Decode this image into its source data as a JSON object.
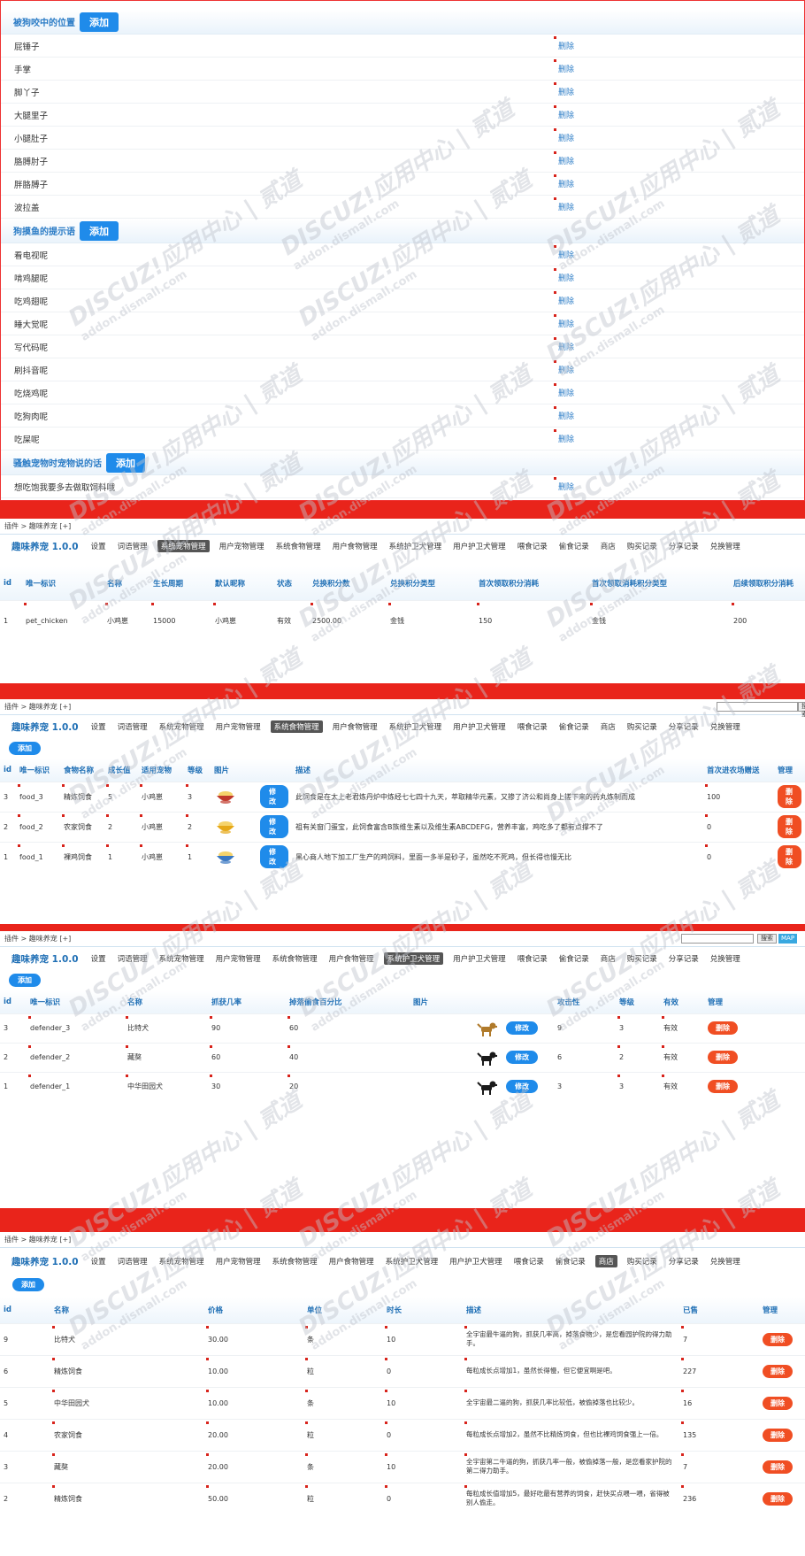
{
  "panel1": {
    "sections": [
      {
        "title": "被狗咬中的位置",
        "add_label": "添加",
        "items": [
          "屁锤子",
          "手掌",
          "脚丫子",
          "大腿里子",
          "小腿肚子",
          "胳膊肘子",
          "胖胳膊子",
          "波拉盖"
        ]
      },
      {
        "title": "狗摸鱼的提示语",
        "add_label": "添加",
        "items": [
          "看电视呢",
          "啃鸡腿呢",
          "吃鸡翅呢",
          "睡大觉呢",
          "写代码呢",
          "刷抖音呢",
          "吃烧鸡呢",
          "吃狗肉呢",
          "吃屎呢"
        ]
      },
      {
        "title": "骚触宠物时宠物说的话",
        "add_label": "添加",
        "items": [
          "想吃饱我要多去做取饲料哦"
        ]
      }
    ],
    "delete_label": "删除"
  },
  "nav": {
    "brand": "趣味养宠 1.0.0",
    "items": [
      "设置",
      "词语管理",
      "系统宠物管理",
      "用户宠物管理",
      "系统食物管理",
      "用户食物管理",
      "系统护卫犬管理",
      "用户护卫犬管理",
      "喂食记录",
      "偷食记录",
      "商店",
      "购买记录",
      "分享记录",
      "兑换管理"
    ]
  },
  "breadcrumb": "插件 > 趣味养宠 [+]",
  "add_label": "添加",
  "edit_label": "修改",
  "delete_label": "删除",
  "search_label": "搜索",
  "map_label": "MAP",
  "panel2": {
    "active_nav": "系统宠物管理",
    "headers": [
      "id",
      "唯一标识",
      "名称",
      "生长周期",
      "默认昵称",
      "状态",
      "兑换积分数",
      "兑换积分类型",
      "首次领取积分消耗",
      "首次领取消耗积分类型",
      "后续领取积分消耗"
    ],
    "rows": [
      [
        "1",
        "pet_chicken",
        "小鸡崽",
        "15000",
        "小鸡崽",
        "有效",
        "2500.00",
        "金钱",
        "150",
        "金钱",
        "200"
      ]
    ]
  },
  "panel3": {
    "active_nav": "系统食物管理",
    "headers": [
      "id",
      "唯一标识",
      "食物名称",
      "成长值",
      "适用宠物",
      "等级",
      "图片",
      "",
      "描述",
      "首次进农场赠送",
      "管理"
    ],
    "rows": [
      {
        "id": "3",
        "key": "food_3",
        "name": "精炼饲食",
        "growth": "5",
        "pet": "小鸡崽",
        "level": "3",
        "desc": "此饲食是在太上老君炼丹炉中炼经七七四十九天，萃取精华元素，又掺了济公和尚身上搓下来的药丸炼制而成",
        "gift": "100",
        "color": "#c0392b"
      },
      {
        "id": "2",
        "key": "food_2",
        "name": "农家饲食",
        "growth": "2",
        "pet": "小鸡崽",
        "level": "2",
        "desc": "祖有关窗门蛋宝，此饲食富含B族维生素以及维生素ABCDEFG，营养丰富，鸡吃多了都有点撑不了",
        "gift": "0",
        "color": "#e6a817"
      },
      {
        "id": "1",
        "key": "food_1",
        "name": "裸鸡饲食",
        "growth": "1",
        "pet": "小鸡崽",
        "level": "1",
        "desc": "黑心商人地下加工厂生产的鸡饲料，里面一多半是砂子，虽然吃不死鸡，但长得也慢无比",
        "gift": "0",
        "color": "#3a78c2"
      }
    ]
  },
  "panel4": {
    "active_nav": "系统护卫犬管理",
    "headers": [
      "id",
      "唯一标识",
      "名称",
      "抓获几率",
      "掉落偷食百分比",
      "图片",
      "",
      "攻击性",
      "等级",
      "有效",
      "管理"
    ],
    "rows": [
      {
        "id": "3",
        "key": "defender_3",
        "name": "比特犬",
        "rate": "90",
        "pct": "60",
        "attack": "9",
        "level": "3",
        "valid": "有效",
        "color": "#b07a2a"
      },
      {
        "id": "2",
        "key": "defender_2",
        "name": "藏獒",
        "rate": "60",
        "pct": "40",
        "attack": "6",
        "level": "2",
        "valid": "有效",
        "color": "#1a1a1a"
      },
      {
        "id": "1",
        "key": "defender_1",
        "name": "中华田园犬",
        "rate": "30",
        "pct": "20",
        "attack": "3",
        "level": "3",
        "valid": "有效",
        "color": "#1a1a1a"
      }
    ]
  },
  "panel5": {
    "active_nav": "商店",
    "headers": [
      "id",
      "名称",
      "价格",
      "单位",
      "时长",
      "描述",
      "已售",
      "管理"
    ],
    "rows": [
      {
        "id": "9",
        "name": "比特犬",
        "price": "30.00",
        "unit": "条",
        "dur": "10",
        "desc": "全宇宙最牛逼的狗，抓获几率高，掉落食物少，是您看园护院的得力助手。",
        "sold": "7"
      },
      {
        "id": "6",
        "name": "精炼饲食",
        "price": "10.00",
        "unit": "粒",
        "dur": "0",
        "desc": "每粒成长点增加1，虽然长得慢，但它便宜啊是吧。",
        "sold": "227"
      },
      {
        "id": "5",
        "name": "中华田园犬",
        "price": "10.00",
        "unit": "条",
        "dur": "10",
        "desc": "全宇宙最二逼的狗，抓获几率比较低，被偷掉落也比较少。",
        "sold": "16"
      },
      {
        "id": "4",
        "name": "农家饲食",
        "price": "20.00",
        "unit": "粒",
        "dur": "0",
        "desc": "每粒成长点增加2，虽然不比精炼饲食，但也比裸鸡饲食强上一倍。",
        "sold": "135"
      },
      {
        "id": "3",
        "name": "藏獒",
        "price": "20.00",
        "unit": "条",
        "dur": "10",
        "desc": "全宇宙第二牛逼的狗，抓获几率一般，被偷掉落一般，是您看家护院的第二得力助手。",
        "sold": "7"
      },
      {
        "id": "2",
        "name": "精炼饲食",
        "price": "50.00",
        "unit": "粒",
        "dur": "0",
        "desc": "每粒成长值增加5，最好吃最有营养的饲食，赶快买点喂一喂，省得被别人偷走。",
        "sold": "236"
      }
    ]
  }
}
